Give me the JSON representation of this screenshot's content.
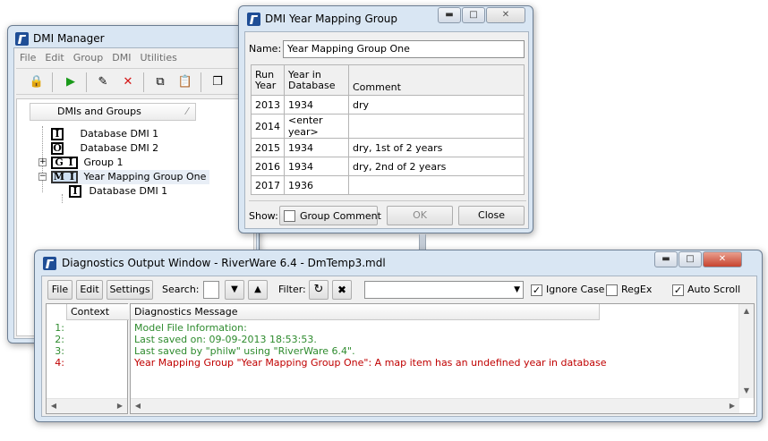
{
  "dmi_manager": {
    "title": "DMI Manager",
    "menu": [
      "File",
      "Edit",
      "Group",
      "DMI",
      "Utilities"
    ],
    "tree_header": "DMIs and Groups",
    "tree": [
      {
        "badge": "I",
        "label": "Database DMI 1"
      },
      {
        "badge": "O",
        "label": "Database DMI 2"
      },
      {
        "badge": "G I",
        "label": "Group 1"
      },
      {
        "badge": "M I",
        "label": "Year Mapping Group One"
      },
      {
        "badge": "I",
        "label": "Database DMI 1"
      }
    ]
  },
  "mapping": {
    "title": "DMI Year Mapping Group",
    "name_label": "Name:",
    "name_value": "Year Mapping Group One",
    "col_run_year": [
      "Run",
      "Year"
    ],
    "col_year_db": [
      "Year in",
      "Database"
    ],
    "col_comment": "Comment",
    "rows": [
      {
        "run": "2013",
        "db": "1934",
        "comment": "dry"
      },
      {
        "run": "2014",
        "db": "<enter year>",
        "comment": ""
      },
      {
        "run": "2015",
        "db": "1934",
        "comment": "dry, 1st of 2 years"
      },
      {
        "run": "2016",
        "db": "1934",
        "comment": "dry, 2nd of 2 years"
      },
      {
        "run": "2017",
        "db": "1936",
        "comment": ""
      }
    ],
    "show_label": "Show:",
    "group_comment": "Group Comment",
    "ok": "OK",
    "close": "Close"
  },
  "diagnostics": {
    "title": "Diagnostics Output Window - RiverWare 6.4 - DmTemp3.mdl",
    "file": "File",
    "edit": "Edit",
    "settings": "Settings",
    "search_label": "Search:",
    "filter_label": "Filter:",
    "ignore_case": "Ignore Case",
    "regex": "RegEx",
    "auto_scroll": "Auto Scroll",
    "col_context": "Context",
    "col_message": "Diagnostics Message",
    "lines": [
      {
        "num": "1:",
        "text": "Model File Information:",
        "color": "#2e8b2e"
      },
      {
        "num": "2:",
        "text": "Last saved on: 09-09-2013 18:53:53.",
        "color": "#2e8b2e"
      },
      {
        "num": "3:",
        "text": "Last saved by \"philw\" using \"RiverWare 6.4\".",
        "color": "#2e8b2e"
      },
      {
        "num": "4:",
        "text": "Year Mapping Group \"Year Mapping Group One\": A map item has an undefined year in database",
        "color": "#c00000"
      }
    ]
  }
}
